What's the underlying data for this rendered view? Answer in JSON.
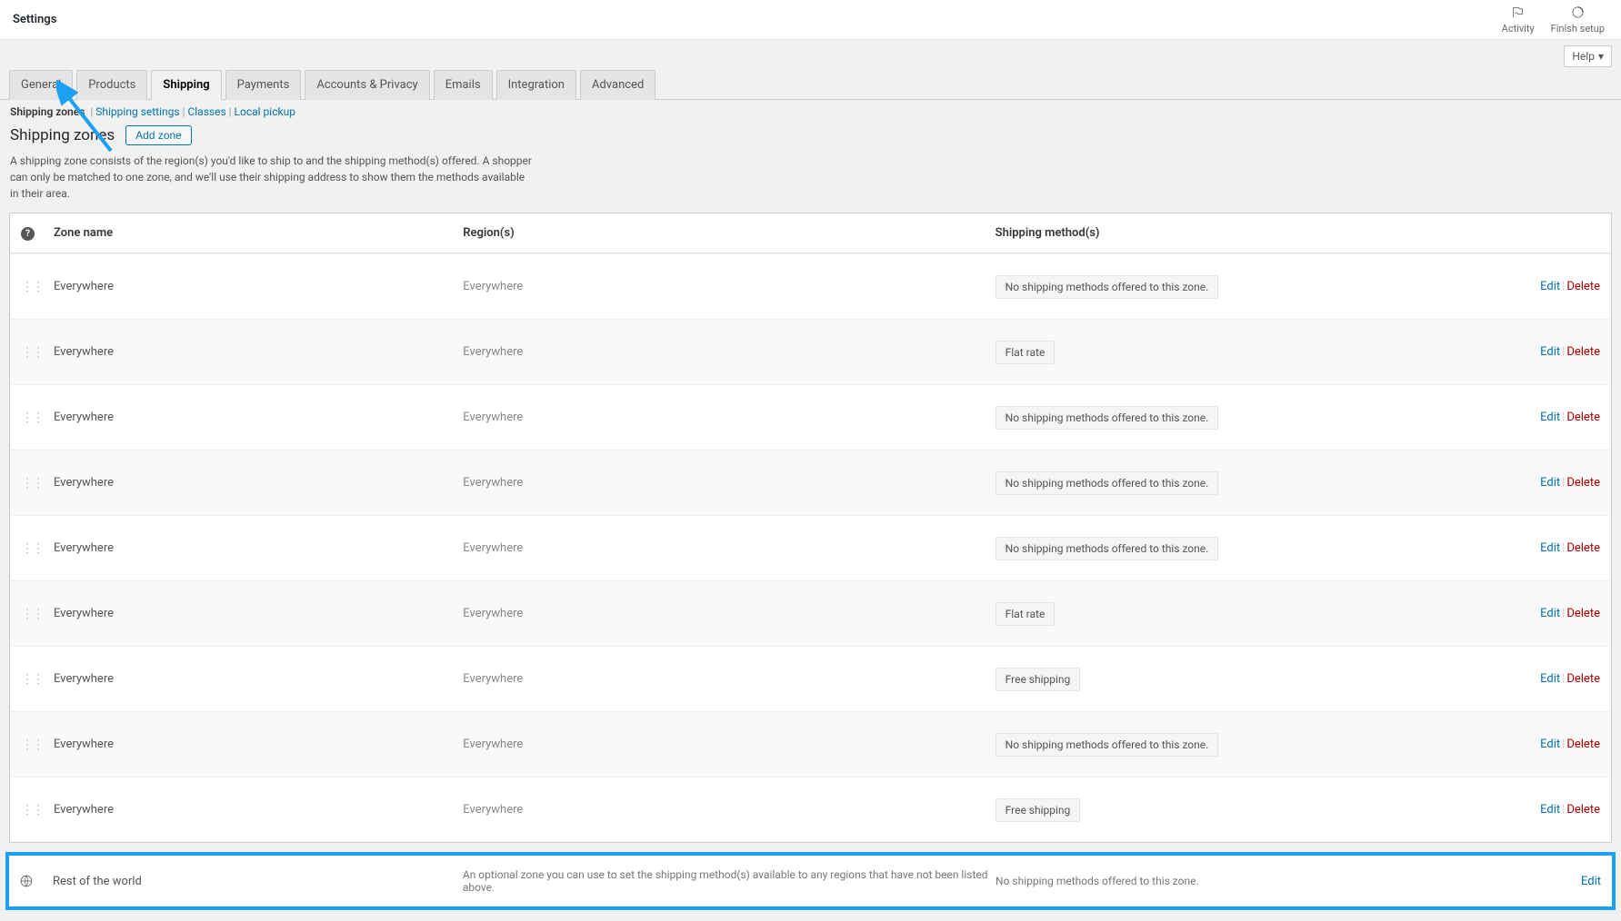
{
  "topbar": {
    "title": "Settings",
    "activity": "Activity",
    "finish_setup": "Finish setup"
  },
  "help_label": "Help",
  "tabs": [
    {
      "label": "General",
      "active": false
    },
    {
      "label": "Products",
      "active": false
    },
    {
      "label": "Shipping",
      "active": true
    },
    {
      "label": "Payments",
      "active": false
    },
    {
      "label": "Accounts & Privacy",
      "active": false
    },
    {
      "label": "Emails",
      "active": false
    },
    {
      "label": "Integration",
      "active": false
    },
    {
      "label": "Advanced",
      "active": false
    }
  ],
  "subnav": {
    "current": "Shipping zones",
    "items": [
      "Shipping settings",
      "Classes",
      "Local pickup"
    ]
  },
  "heading": {
    "title": "Shipping zones",
    "add_btn": "Add zone",
    "desc": "A shipping zone consists of the region(s) you'd like to ship to and the shipping method(s) offered. A shopper can only be matched to one zone, and we'll use their shipping address to show them the methods available in their area."
  },
  "table": {
    "col_zone": "Zone name",
    "col_region": "Region(s)",
    "col_method": "Shipping method(s)",
    "edit": "Edit",
    "delete": "Delete",
    "no_methods": "No shipping methods offered to this zone.",
    "rows": [
      {
        "name": "Everywhere",
        "region": "Everywhere",
        "method": "__none__"
      },
      {
        "name": "Everywhere",
        "region": "Everywhere",
        "method": "Flat rate"
      },
      {
        "name": "Everywhere",
        "region": "Everywhere",
        "method": "__none__"
      },
      {
        "name": "Everywhere",
        "region": "Everywhere",
        "method": "__none__"
      },
      {
        "name": "Everywhere",
        "region": "Everywhere",
        "method": "__none__"
      },
      {
        "name": "Everywhere",
        "region": "Everywhere",
        "method": "Flat rate"
      },
      {
        "name": "Everywhere",
        "region": "Everywhere",
        "method": "Free shipping"
      },
      {
        "name": "Everywhere",
        "region": "Everywhere",
        "method": "__none__"
      },
      {
        "name": "Everywhere",
        "region": "Everywhere",
        "method": "Free shipping"
      }
    ]
  },
  "rest": {
    "name": "Rest of the world",
    "desc": "An optional zone you can use to set the shipping method(s) available to any regions that have not been listed above.",
    "method": "No shipping methods offered to this zone.",
    "edit": "Edit"
  }
}
